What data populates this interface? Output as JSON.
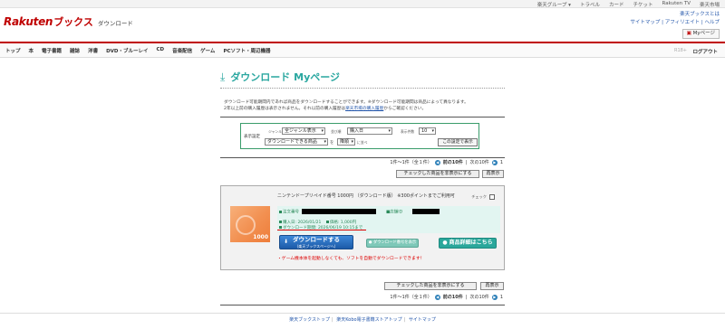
{
  "topbar": {
    "links": [
      "楽天グループ ▾",
      "トラベル",
      "カード",
      "チケット",
      "Rakuten TV",
      "楽天市場"
    ]
  },
  "header": {
    "brand": "Rakuten",
    "brand_sub": "ブックス",
    "section": "ダウンロード",
    "right_row1": "楽天ブックスとは",
    "right_row2": [
      "サイトマップ",
      "アフィリエイト",
      "ヘルプ"
    ],
    "mypage": "Myページ"
  },
  "nav": {
    "items": [
      "トップ",
      "本",
      "電子書籍",
      "雑誌",
      "洋書",
      "DVD・ブルーレイ",
      "CD",
      "音楽配信",
      "ゲーム",
      "PCソフト・周辺機器"
    ],
    "r18": "R18+",
    "logout": "ログアウト"
  },
  "page": {
    "title": "ダウンロード Myページ",
    "notice_1": "ダウンロード可能期間内であれば商品をダウンロードすることができます。※ダウンロード可能期間は商品によって異なります。",
    "notice_2a": "2年以上前の購入履歴は表示されません。それ以前の購入履歴は",
    "notice_link": "楽天市場の購入履歴",
    "notice_2b": "からご確認ください。"
  },
  "filter": {
    "label": "表示設定",
    "genre_lbl": "ジャンル",
    "genre": "全ジャンル表示",
    "order_lbl": "並び順",
    "order": "購入日",
    "count_lbl": "表示件数",
    "count": "10",
    "status": "ダウンロードできる商品",
    "status_suffix": "を",
    "sort_dir": "降順",
    "sort_suffix": "に並べ",
    "apply": "この設定で表示"
  },
  "pager": {
    "summary": "1件～1件（全１件）",
    "prev": "前の10件",
    "sep": "|",
    "next": "次の10件",
    "page": "1"
  },
  "actions": {
    "hide_checked": "チェックした商品を非表示にする",
    "redisplay": "再表示"
  },
  "item": {
    "name": "ニンテンドープリペイド番号 1000円 （ダウンロード版） ※300ポイントまでご利用可",
    "check_label": "チェック",
    "thumb_amount": "1000",
    "order_no_label": "注文番号",
    "shop_no_label": "■店舗ID",
    "purchase_date": "購入日: 2026/01/21",
    "price": "価格: 1,000円",
    "dl_period": "ダウンロード期間: 2026/06/19 10:15まで",
    "download_main": "ダウンロードする",
    "download_sub": "(楽天ブックスページへ)",
    "dl_number_btn": "ダウンロード番号を表示",
    "detail_btn": "商品詳細はこちら",
    "warning": "・ゲーム機本体を起動しなくても、ソフトを自動でダウンロードできます！"
  },
  "footer": {
    "links": [
      "楽天ブックストップ",
      "楽天Kobo電子書籍ストアトップ",
      "サイトマップ"
    ]
  },
  "colors": {
    "brand_red": "#bf0000",
    "teal": "#2aa7a0",
    "info_bg": "#e2f5f1",
    "download_blue": "#1c5aa8"
  }
}
